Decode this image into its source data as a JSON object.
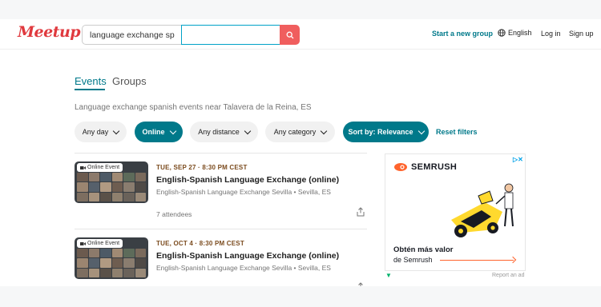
{
  "header": {
    "logo": "Meetup",
    "search_value": "language exchange sp",
    "location_value": "",
    "start_group": "Start a new group",
    "language": "English",
    "login": "Log in",
    "signup": "Sign up"
  },
  "tabs": {
    "events": "Events",
    "groups": "Groups"
  },
  "subtitle": "Language exchange spanish events near Talavera de la Reina, ES",
  "filters": {
    "day": "Any day",
    "type": "Online",
    "distance": "Any distance",
    "category": "Any category",
    "sort": "Sort by: Relevance",
    "reset": "Reset filters"
  },
  "events": [
    {
      "badge": "Online Event",
      "date": "TUE, SEP 27 · 8:30 PM CEST",
      "title": "English-Spanish Language Exchange (online)",
      "group": "English-Spanish Language Exchange Sevilla • Sevilla, ES",
      "attendees": "7 attendees"
    },
    {
      "badge": "Online Event",
      "date": "TUE, OCT 4 · 8:30 PM CEST",
      "title": "English-Spanish Language Exchange (online)",
      "group": "English-Spanish Language Exchange Sevilla • Sevilla, ES",
      "attendees": ""
    }
  ],
  "ad": {
    "brand": "SEMRUSH",
    "headline": "Obtén más valor",
    "cta": "de Semrush",
    "report": "Report an ad",
    "accent_color": "#ff642d"
  },
  "colors": {
    "brand": "#e0393e",
    "teal": "#00798a",
    "search_button": "#f05e5e"
  }
}
